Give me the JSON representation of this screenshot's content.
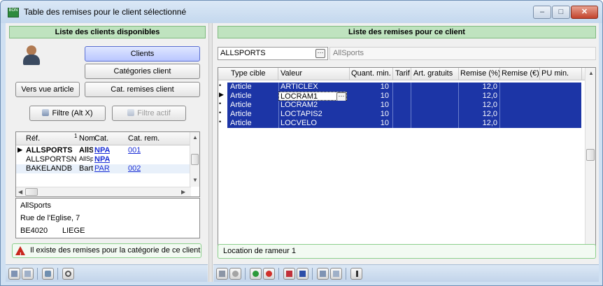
{
  "window": {
    "title": "Table des remises pour le client sélectionné",
    "app_icon_text": "BON",
    "controls": {
      "minimize": "–",
      "maximize": "□",
      "close": "✕"
    }
  },
  "left_panel": {
    "header": "Liste des clients disponibles",
    "buttons": {
      "clients": "Clients",
      "categories_client": "Catégories client",
      "vers_vue_article": "Vers vue article",
      "cat_remises_client": "Cat. remises client",
      "filtre": "Filtre (Alt X)",
      "filtre_actif": "Filtre actif"
    },
    "grid": {
      "columns": [
        "Réf.",
        "Nom",
        "Cat.",
        "Cat. rem."
      ],
      "sort_indicator": "1",
      "rows": [
        {
          "ref": "ALLSPORTS",
          "nom": "AllSport",
          "cat": "NPA",
          "cat_rem": "001"
        },
        {
          "ref": "ALLSPORTSN",
          "nom": "AllSport",
          "cat": "NPA",
          "cat_rem": ""
        },
        {
          "ref": "BAKELANDB",
          "nom": "Bart Ba",
          "cat": "PAR",
          "cat_rem": "002"
        }
      ]
    },
    "address": {
      "name": "AllSports",
      "street": "Rue de l'Eglise, 7",
      "postal_code": "BE4020",
      "city": "LIEGE"
    },
    "status": "Il existe des remises pour la catégorie de ce client"
  },
  "right_panel": {
    "header": "Liste des remises pour ce client",
    "client_code": "ALLSPORTS",
    "client_name": "AllSports",
    "grid": {
      "columns": [
        "Type cible",
        "Valeur",
        "Quant. min.",
        "Tarif",
        "Art. gratuits",
        "Remise (%)",
        "Remise (€)",
        "PU min."
      ],
      "rows": [
        {
          "type": "Article",
          "valeur": "ARTICLEX",
          "quant": "10",
          "remise_pct": "12,0"
        },
        {
          "type": "Article",
          "valeur": "LOCRAM1",
          "quant": "10",
          "remise_pct": "12,0"
        },
        {
          "type": "Article",
          "valeur": "LOCRAM2",
          "quant": "10",
          "remise_pct": "12,0"
        },
        {
          "type": "Article",
          "valeur": "LOCTAPIS2",
          "quant": "10",
          "remise_pct": "12,0"
        },
        {
          "type": "Article",
          "valeur": "LOCVELO",
          "quant": "10",
          "remise_pct": "12,0"
        }
      ]
    },
    "status": "Location de rameur 1"
  },
  "colors": {
    "selection_band": "#1c35a6",
    "panel_header_bg": "#bfe3bf",
    "link": "#1a2ed6",
    "warning": "#c8271f"
  }
}
